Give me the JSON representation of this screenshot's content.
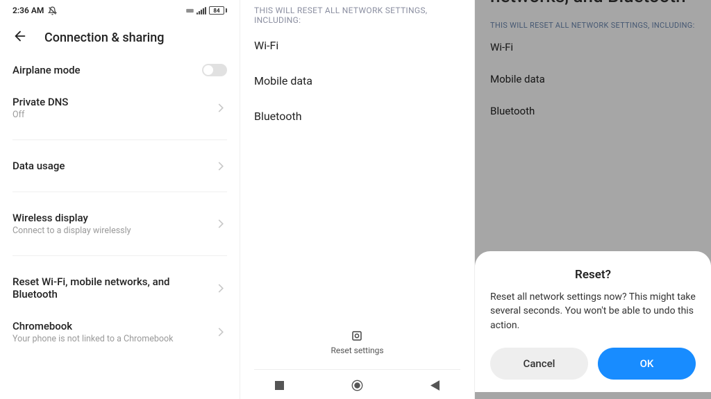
{
  "panel1": {
    "status_time": "2:36 AM",
    "battery_pct": "84",
    "title": "Connection & sharing",
    "rows": {
      "airplane": {
        "label": "Airplane mode"
      },
      "private_dns": {
        "label": "Private DNS",
        "sub": "Off"
      },
      "data_usage": {
        "label": "Data usage"
      },
      "wireless_display": {
        "label": "Wireless display",
        "sub": "Connect to a display wirelessly"
      },
      "reset_net": {
        "label": "Reset Wi-Fi, mobile networks, and Bluetooth"
      },
      "chromebook": {
        "label": "Chromebook",
        "sub": "Your phone is not linked to a Chromebook"
      }
    }
  },
  "panel2": {
    "caption": "This will reset all network settings, including:",
    "items": {
      "wifi": "Wi-Fi",
      "mobile": "Mobile data",
      "bt": "Bluetooth"
    },
    "reset_button": "Reset settings"
  },
  "panel3": {
    "partial_title": "networks, and Bluetooth",
    "caption": "This will reset all network settings, including:",
    "items": {
      "wifi": "Wi-Fi",
      "mobile": "Mobile data",
      "bt": "Bluetooth"
    },
    "dialog": {
      "title": "Reset?",
      "body": "Reset all network settings now? This might take several seconds. You won't be able to undo this action.",
      "cancel": "Cancel",
      "ok": "OK"
    }
  }
}
